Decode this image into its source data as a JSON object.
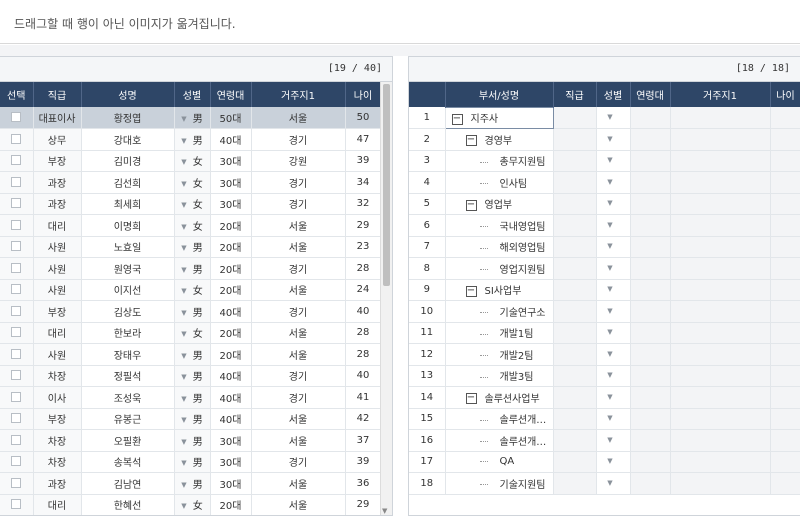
{
  "banner": {
    "message": "드래그할 때 행이 아닌 이미지가 옮겨집니다."
  },
  "left_grid": {
    "count": "[19 / 40]",
    "columns": [
      "선택",
      "직급",
      "성명",
      "성별",
      "연령대",
      "거주지1",
      "나이"
    ],
    "rows": [
      {
        "rank": "대표이사",
        "name": "황정엽",
        "gender": "男",
        "age_group": "50대",
        "residence": "서울",
        "age": "50"
      },
      {
        "rank": "상무",
        "name": "강대호",
        "gender": "男",
        "age_group": "40대",
        "residence": "경기",
        "age": "47"
      },
      {
        "rank": "부장",
        "name": "김미경",
        "gender": "女",
        "age_group": "30대",
        "residence": "강원",
        "age": "39"
      },
      {
        "rank": "과장",
        "name": "김선희",
        "gender": "女",
        "age_group": "30대",
        "residence": "경기",
        "age": "34"
      },
      {
        "rank": "과장",
        "name": "최세희",
        "gender": "女",
        "age_group": "30대",
        "residence": "경기",
        "age": "32"
      },
      {
        "rank": "대리",
        "name": "이명희",
        "gender": "女",
        "age_group": "20대",
        "residence": "서울",
        "age": "29"
      },
      {
        "rank": "사원",
        "name": "노효일",
        "gender": "男",
        "age_group": "20대",
        "residence": "서울",
        "age": "23"
      },
      {
        "rank": "사원",
        "name": "원영국",
        "gender": "男",
        "age_group": "20대",
        "residence": "경기",
        "age": "28"
      },
      {
        "rank": "사원",
        "name": "이지선",
        "gender": "女",
        "age_group": "20대",
        "residence": "서울",
        "age": "24"
      },
      {
        "rank": "부장",
        "name": "김상도",
        "gender": "男",
        "age_group": "40대",
        "residence": "경기",
        "age": "40"
      },
      {
        "rank": "대리",
        "name": "한보라",
        "gender": "女",
        "age_group": "20대",
        "residence": "서울",
        "age": "28"
      },
      {
        "rank": "사원",
        "name": "장태우",
        "gender": "男",
        "age_group": "20대",
        "residence": "서울",
        "age": "28"
      },
      {
        "rank": "차장",
        "name": "정필석",
        "gender": "男",
        "age_group": "40대",
        "residence": "경기",
        "age": "40"
      },
      {
        "rank": "이사",
        "name": "조성욱",
        "gender": "男",
        "age_group": "40대",
        "residence": "경기",
        "age": "41"
      },
      {
        "rank": "부장",
        "name": "유봉근",
        "gender": "男",
        "age_group": "40대",
        "residence": "서울",
        "age": "42"
      },
      {
        "rank": "차장",
        "name": "오필환",
        "gender": "男",
        "age_group": "30대",
        "residence": "서울",
        "age": "37"
      },
      {
        "rank": "차장",
        "name": "송복석",
        "gender": "男",
        "age_group": "30대",
        "residence": "경기",
        "age": "39"
      },
      {
        "rank": "과장",
        "name": "김남연",
        "gender": "男",
        "age_group": "30대",
        "residence": "서울",
        "age": "36"
      },
      {
        "rank": "대리",
        "name": "한혜선",
        "gender": "女",
        "age_group": "20대",
        "residence": "서울",
        "age": "29"
      }
    ]
  },
  "right_grid": {
    "count": "[18 / 18]",
    "columns": [
      "부서/성명",
      "직급",
      "성별",
      "연령대",
      "거주지1",
      "나이"
    ],
    "rows": [
      {
        "num": "1",
        "name": "지주사",
        "level": 0,
        "toggle": "−"
      },
      {
        "num": "2",
        "name": "경영부",
        "level": 1,
        "toggle": "−"
      },
      {
        "num": "3",
        "name": "총무지원팀",
        "level": 2,
        "toggle": ""
      },
      {
        "num": "4",
        "name": "인사팀",
        "level": 2,
        "toggle": ""
      },
      {
        "num": "5",
        "name": "영업부",
        "level": 1,
        "toggle": "−"
      },
      {
        "num": "6",
        "name": "국내영업팀",
        "level": 2,
        "toggle": ""
      },
      {
        "num": "7",
        "name": "해외영업팀",
        "level": 2,
        "toggle": ""
      },
      {
        "num": "8",
        "name": "영업지원팀",
        "level": 2,
        "toggle": ""
      },
      {
        "num": "9",
        "name": "SI사업부",
        "level": 1,
        "toggle": "−"
      },
      {
        "num": "10",
        "name": "기술연구소",
        "level": 2,
        "toggle": ""
      },
      {
        "num": "11",
        "name": "개발1팀",
        "level": 2,
        "toggle": ""
      },
      {
        "num": "12",
        "name": "개발2팀",
        "level": 2,
        "toggle": ""
      },
      {
        "num": "13",
        "name": "개발3팀",
        "level": 2,
        "toggle": ""
      },
      {
        "num": "14",
        "name": "솔루션사업부",
        "level": 1,
        "toggle": "−"
      },
      {
        "num": "15",
        "name": "솔루션개…",
        "level": 2,
        "toggle": ""
      },
      {
        "num": "16",
        "name": "솔루션개…",
        "level": 2,
        "toggle": ""
      },
      {
        "num": "17",
        "name": "QA",
        "level": 2,
        "toggle": ""
      },
      {
        "num": "18",
        "name": "기술지원팀",
        "level": 2,
        "toggle": ""
      }
    ]
  },
  "icons": {
    "dropdown": "dropdown-arrow-icon",
    "checkbox": "checkbox-icon",
    "scroll_down": "scroll-down-arrow-icon"
  }
}
